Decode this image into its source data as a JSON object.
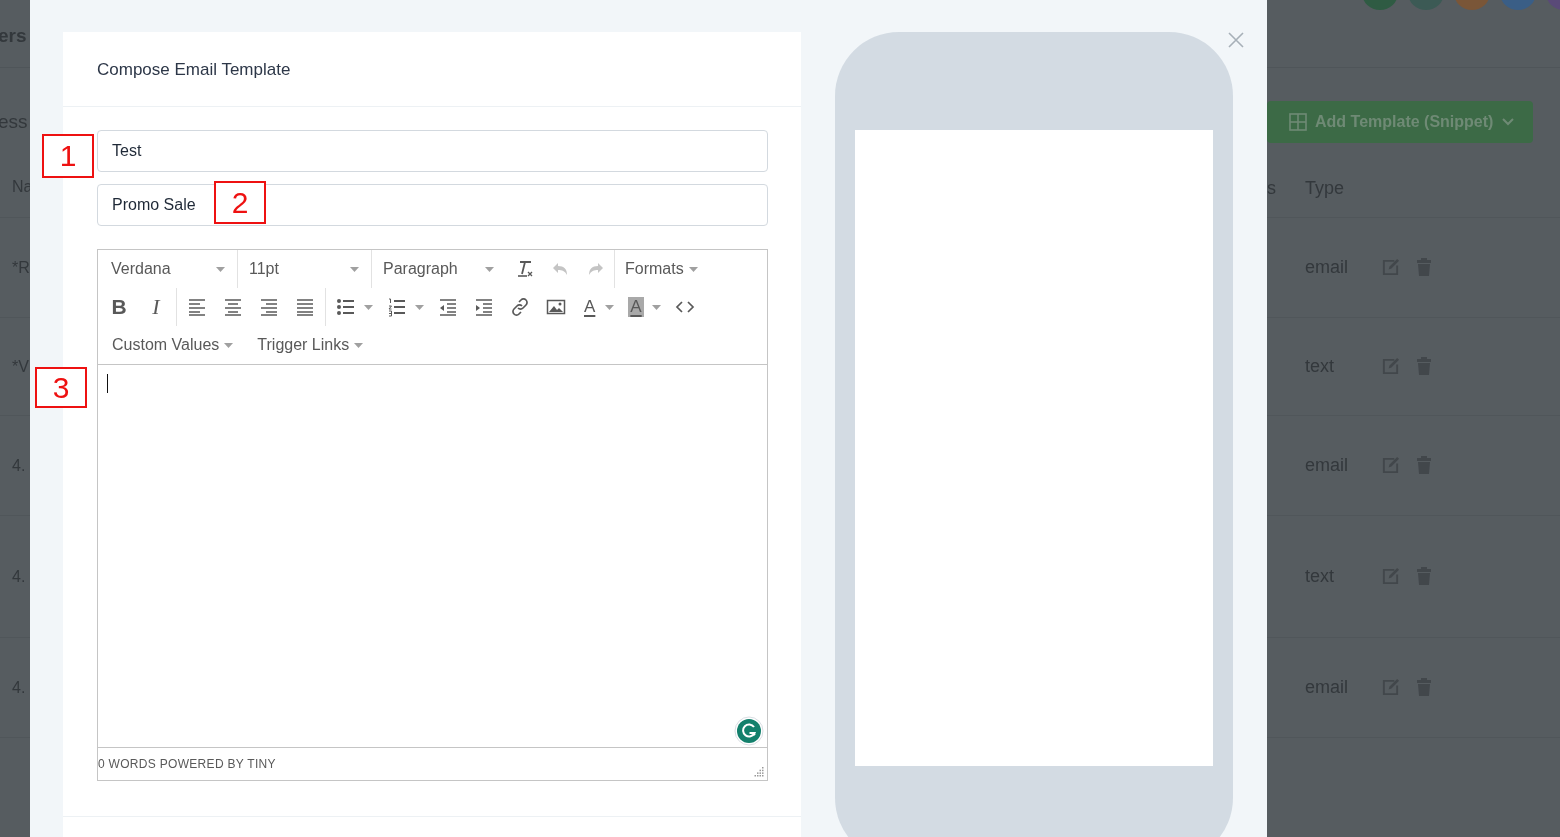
{
  "page": {
    "header_text": "ers",
    "section_text": "ess",
    "add_template_button": "Add Template (Snippet)",
    "avatars": [
      {
        "color": "#2f5b43"
      },
      {
        "color": "#3c5a55"
      },
      {
        "color": "#7a5638"
      },
      {
        "color": "#3a5e86"
      },
      {
        "color": "#5a4a78"
      }
    ],
    "table": {
      "columns": [
        "Na",
        "s",
        "Type"
      ],
      "rows": [
        {
          "name": "*R",
          "type": "email"
        },
        {
          "name": "*V",
          "type": "text"
        },
        {
          "name": "4.",
          "type": "email"
        },
        {
          "name": "4.",
          "type": "text"
        },
        {
          "name": "4.",
          "type": "email"
        }
      ]
    }
  },
  "modal": {
    "title": "Compose Email Template",
    "name_field": {
      "value": "Test"
    },
    "subject_field": {
      "value": "Promo Sale"
    },
    "editor": {
      "selects": [
        "Verdana",
        "11pt",
        "Paragraph"
      ],
      "row1_buttons": [
        {
          "kind": "clear-format",
          "disabled": false
        },
        {
          "kind": "undo",
          "disabled": true
        },
        {
          "kind": "redo",
          "disabled": true
        }
      ],
      "formats_menu": "Formats",
      "row2_buttons": [
        {
          "kind": "bold",
          "text": "B"
        },
        {
          "kind": "italic",
          "text": "I"
        },
        {
          "kind": "sep"
        },
        {
          "kind": "align-left"
        },
        {
          "kind": "align-center"
        },
        {
          "kind": "align-right"
        },
        {
          "kind": "justify"
        },
        {
          "kind": "sep"
        },
        {
          "kind": "bullet-list"
        },
        {
          "kind": "number-list"
        },
        {
          "kind": "outdent"
        },
        {
          "kind": "indent"
        },
        {
          "kind": "link"
        },
        {
          "kind": "image"
        },
        {
          "kind": "text-color",
          "text": "A"
        },
        {
          "kind": "bg-color",
          "text": "A"
        },
        {
          "kind": "code"
        }
      ],
      "menus": [
        "Custom Values",
        "Trigger Links"
      ],
      "status": "0 WORDS POWERED BY TINY"
    }
  },
  "annotations": [
    {
      "label": "1"
    },
    {
      "label": "2"
    },
    {
      "label": "3"
    }
  ]
}
